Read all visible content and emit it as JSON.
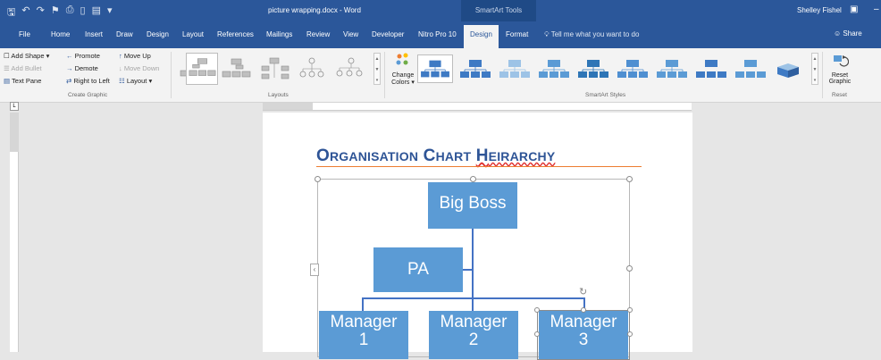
{
  "titlebar": {
    "doc_title": "picture wrapping.docx - Word",
    "context_group": "SmartArt Tools",
    "user": "Shelley Fishel",
    "qat_icons": [
      "save-icon",
      "undo-icon",
      "redo-icon",
      "format-painter-icon",
      "print-icon",
      "new-doc-icon",
      "open-icon",
      "customize-icon"
    ]
  },
  "tabs": [
    "File",
    "Home",
    "Insert",
    "Draw",
    "Design",
    "Layout",
    "References",
    "Mailings",
    "Review",
    "View",
    "Developer",
    "Nitro Pro 10",
    "Design",
    "Format"
  ],
  "active_tab": "Design",
  "tell_me": "Tell me what you want to do",
  "share": "Share",
  "ribbon": {
    "create_graphic": {
      "add_shape": "Add Shape",
      "add_bullet": "Add Bullet",
      "text_pane": "Text Pane",
      "promote": "Promote",
      "demote": "Demote",
      "right_to_left": "Right to Left",
      "move_up": "Move Up",
      "move_down": "Move Down",
      "layout": "Layout",
      "label": "Create Graphic"
    },
    "layouts_label": "Layouts",
    "change_colors_1": "Change",
    "change_colors_2": "Colors",
    "styles_label": "SmartArt Styles",
    "reset_graphic_1": "Reset",
    "reset_graphic_2": "Graphic",
    "reset_label": "Reset"
  },
  "document": {
    "heading_1a": "O",
    "heading_1b": "RGANISATION",
    "heading_2a": "C",
    "heading_2b": "HART",
    "heading_3a": "H",
    "heading_3b": "EIRARCHY"
  },
  "org_chart": {
    "top": "Big Boss",
    "assistant": "PA",
    "managers": [
      {
        "l1": "Manager",
        "l2": "1"
      },
      {
        "l1": "Manager",
        "l2": "2"
      },
      {
        "l1": "Manager",
        "l2": "3"
      }
    ]
  },
  "colors": {
    "title_bar": "#2b579a",
    "node_fill": "#5b9bd5",
    "connector": "#4472c4",
    "heading_text": "#2e5496",
    "heading_rule": "#ed7d31"
  }
}
